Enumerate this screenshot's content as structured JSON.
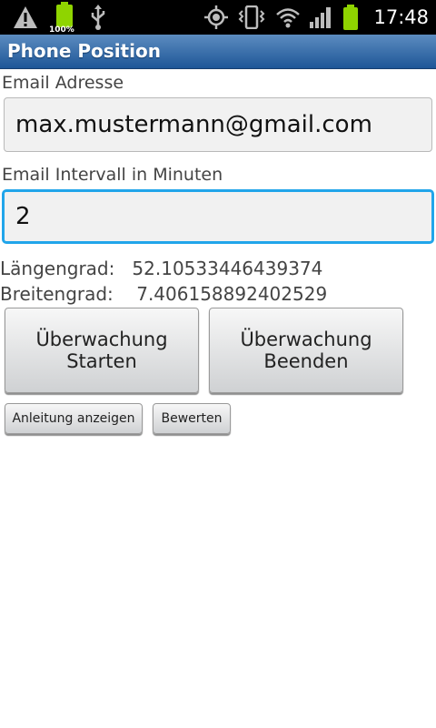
{
  "status_bar": {
    "icons_left": [
      "warning-icon",
      "battery-full-icon",
      "usb-icon"
    ],
    "battery_percent": "100%",
    "icons_right": [
      "gps-icon",
      "vibrate-icon",
      "wifi-icon",
      "signal-icon",
      "battery-icon"
    ],
    "time": "17:48"
  },
  "app": {
    "title": "Phone Position"
  },
  "form": {
    "email_label": "Email Adresse",
    "email_value": "max.mustermann@gmail.com",
    "interval_label": "Email Intervall in Minuten",
    "interval_value": "2"
  },
  "coords": {
    "longitude": "Längengrad:   52.10533446439374",
    "latitude": "Breitengrad:    7.406158892402529"
  },
  "buttons": {
    "start_line1": "Überwachung",
    "start_line2": "Starten",
    "stop_line1": "Überwachung",
    "stop_line2": "Beenden",
    "guide": "Anleitung anzeigen",
    "rate": "Bewerten"
  },
  "colors": {
    "title_bar": "#1e5697",
    "focus_border": "#21a5ea",
    "battery_green": "#8fd400"
  }
}
